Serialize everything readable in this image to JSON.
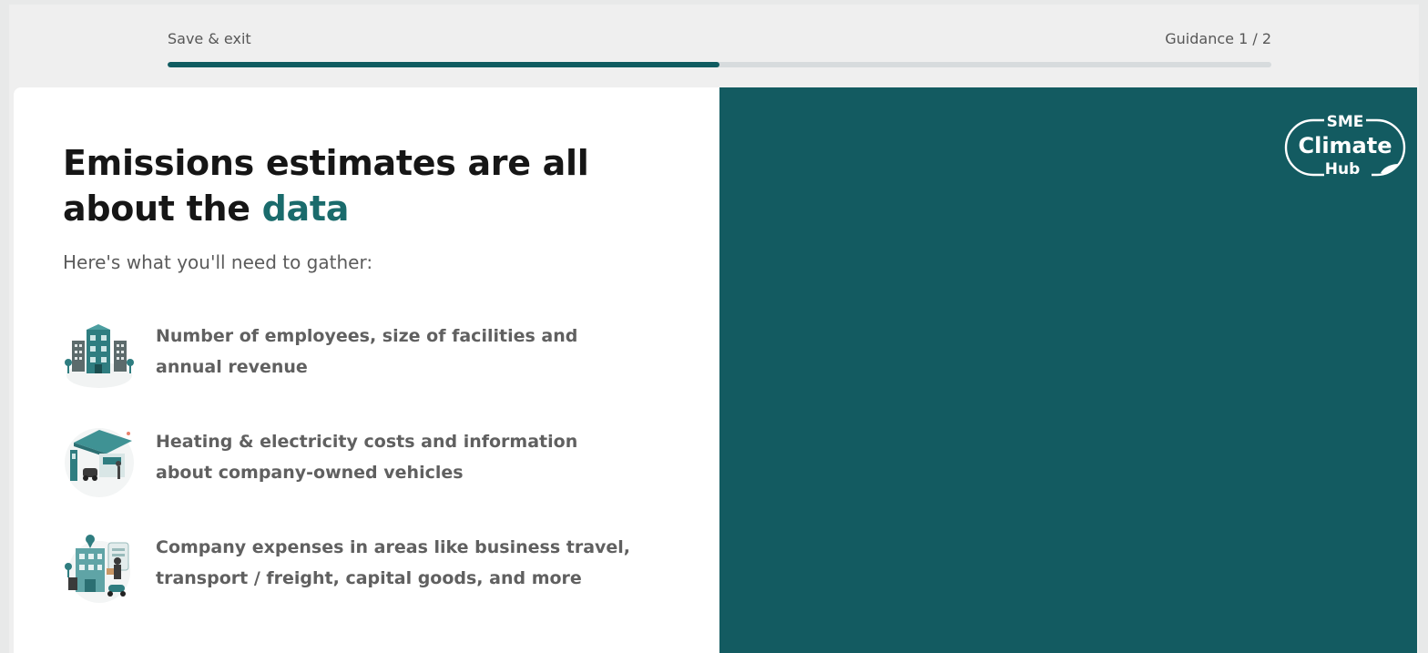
{
  "topbar": {
    "save_exit_label": "Save & exit",
    "guidance_label": "Guidance 1 / 2",
    "progress_fraction": 0.5
  },
  "main": {
    "headline_prefix": "Emissions estimates are all about the",
    "headline_accent": "data",
    "subtitle": "Here's what you'll need to gather:",
    "items": [
      {
        "icon": "buildings-icon",
        "text": "Number of employees, size of facilities and annual revenue"
      },
      {
        "icon": "gas-station-icon",
        "text": "Heating & electricity costs and information about company-owned vehicles"
      },
      {
        "icon": "delivery-building-icon",
        "text": "Company expenses in areas like business travel, transport / freight, capital goods, and more"
      }
    ]
  },
  "logo": {
    "line1": "SME",
    "line2": "Climate",
    "line3": "Hub"
  },
  "colors": {
    "accent": "#0f5b60",
    "panel": "#135b61",
    "track": "#d7dbdd"
  }
}
